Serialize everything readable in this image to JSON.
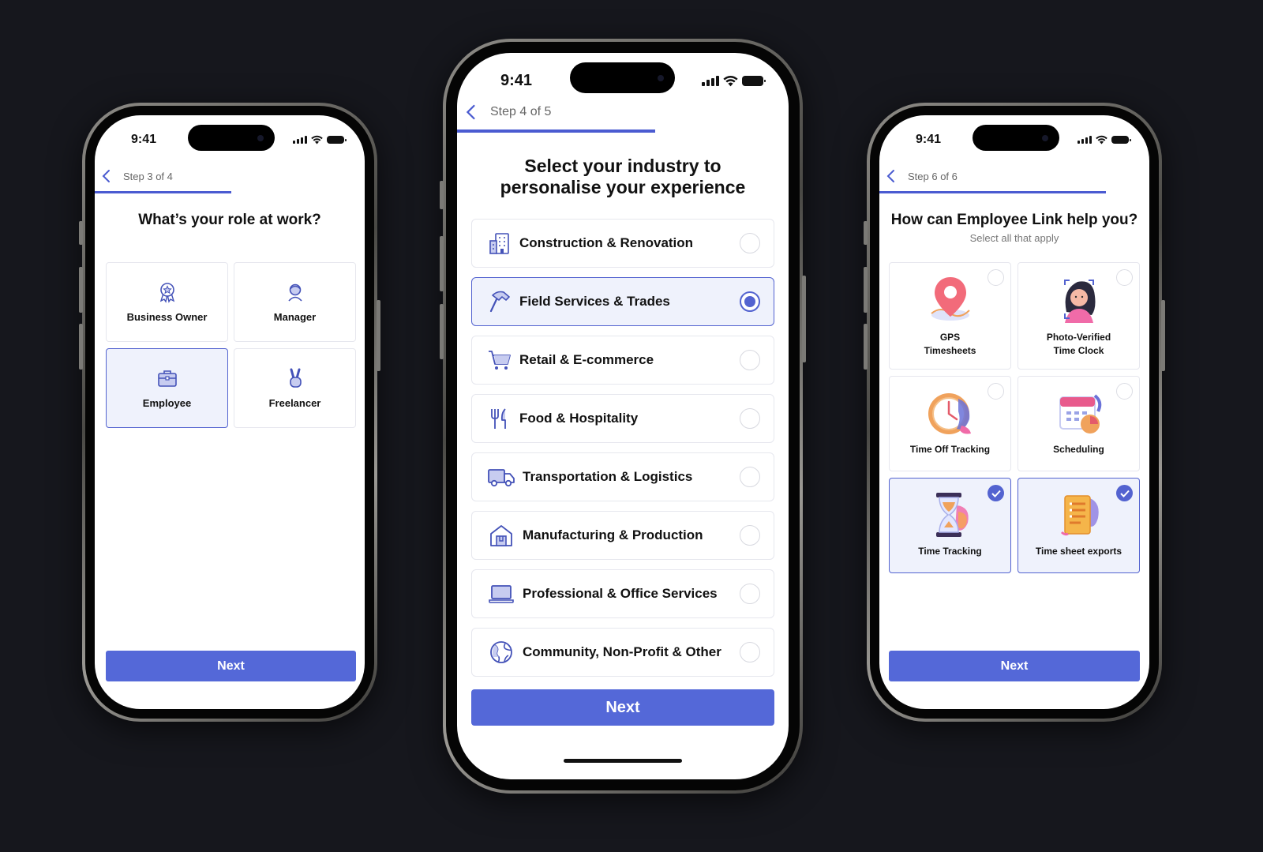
{
  "colors": {
    "background": "#16171d",
    "accent": "#5468d8",
    "selected_fill": "#eff2fc"
  },
  "left": {
    "time": "9:41",
    "step": "Step 3 of 4",
    "progress": 0.5,
    "title": "What’s your role at work?",
    "options": [
      {
        "label": "Business Owner",
        "icon": "award-badge-icon",
        "selected": false
      },
      {
        "label": "Manager",
        "icon": "person-icon",
        "selected": false
      },
      {
        "label": "Employee",
        "icon": "briefcase-icon",
        "selected": true
      },
      {
        "label": "Freelancer",
        "icon": "peace-hand-icon",
        "selected": false
      }
    ],
    "next_label": "Next"
  },
  "middle": {
    "time": "9:41",
    "step": "Step 4 of 5",
    "progress": 0.6,
    "title_line1": "Select your industry to",
    "title_line2": "personalise your experience",
    "options": [
      {
        "label": "Construction & Renovation",
        "icon": "building-icon",
        "selected": false
      },
      {
        "label": "Field Services & Trades",
        "icon": "hammer-icon",
        "selected": true
      },
      {
        "label": "Retail & E-commerce",
        "icon": "shopping-cart-icon",
        "selected": false
      },
      {
        "label": "Food & Hospitality",
        "icon": "fork-knife-icon",
        "selected": false
      },
      {
        "label": "Transportation & Logistics",
        "icon": "truck-icon",
        "selected": false
      },
      {
        "label": "Manufacturing & Production",
        "icon": "factory-icon",
        "selected": false
      },
      {
        "label": "Professional & Office Services",
        "icon": "laptop-icon",
        "selected": false
      },
      {
        "label": "Community, Non-Profit & Other",
        "icon": "globe-icon",
        "selected": false
      }
    ],
    "next_label": "Next"
  },
  "right": {
    "time": "9:41",
    "step": "Step 6 of 6",
    "progress": 0.85,
    "title": "How can Employee Link help you?",
    "subtitle": "Select all that apply",
    "options": [
      {
        "line1": "GPS",
        "line2": "Timesheets",
        "icon": "map-pin-icon",
        "selected": false
      },
      {
        "line1": "Photo-Verified",
        "line2": "Time Clock",
        "icon": "face-scan-icon",
        "selected": false
      },
      {
        "line1": "Time Off Tracking",
        "line2": "",
        "icon": "clock-icon",
        "selected": false
      },
      {
        "line1": "Scheduling",
        "line2": "",
        "icon": "calendar-icon",
        "selected": false
      },
      {
        "line1": "Time Tracking",
        "line2": "",
        "icon": "hourglass-icon",
        "selected": true
      },
      {
        "line1": "Time sheet exports",
        "line2": "",
        "icon": "document-icon",
        "selected": true
      }
    ],
    "next_label": "Next"
  }
}
